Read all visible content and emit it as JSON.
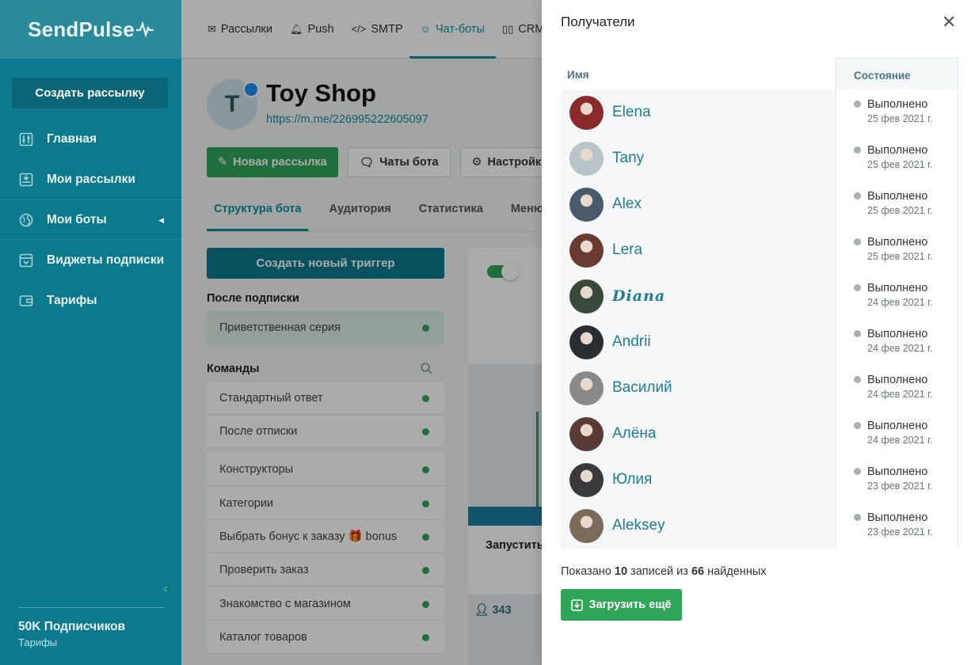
{
  "sidebar": {
    "logo": "SendPulse",
    "create_button": "Создать рассылку",
    "items": [
      {
        "label": "Главная",
        "icon": "sliders-icon"
      },
      {
        "label": "Мои рассылки",
        "icon": "inbox-icon"
      },
      {
        "label": "Мои боты",
        "icon": "globe-icon"
      },
      {
        "label": "Виджеты подписки",
        "icon": "widget-icon"
      },
      {
        "label": "Тарифы",
        "icon": "wallet-icon"
      }
    ],
    "footer_title": "50K Подписчиков",
    "footer_sub": "Тарифы"
  },
  "topnav": [
    {
      "label": "Рассылки",
      "icon": "email-icon"
    },
    {
      "label": "Push",
      "icon": "bell-icon"
    },
    {
      "label": "SMTP",
      "icon": "code-icon"
    },
    {
      "label": "Чат-боты",
      "icon": "chat-icon"
    },
    {
      "label": "CRM",
      "icon": "crm-icon"
    }
  ],
  "bot": {
    "avatar_letter": "T",
    "name": "Toy Shop",
    "link": "https://m.me/226995222605097"
  },
  "actions": {
    "new_campaign": "Новая рассылка",
    "bot_chats": "Чаты бота",
    "settings": "Настройки"
  },
  "subtabs": [
    "Структура бота",
    "Аудитория",
    "Статистика",
    "Меню"
  ],
  "triggers": {
    "create_button": "Создать новый триггер",
    "after_subscribe_title": "После подписки",
    "after_subscribe_item": "Приветственная серия",
    "commands_title": "Команды",
    "commands": [
      "Стандартный ответ",
      "После отписки"
    ],
    "others": [
      "Конструкторы",
      "Категории",
      "Выбрать бонус к заказу 🎁 bonus",
      "Проверить заказ",
      "Знакомство с магазином",
      "Каталог товаров"
    ]
  },
  "flow": {
    "node_text": "Запустить",
    "count": "343"
  },
  "drawer": {
    "title": "Получатели",
    "col_name": "Имя",
    "col_state": "Состояние",
    "recipients": [
      {
        "name": "Elena",
        "status": "Выполнено",
        "date": "25 фев 2021 г.",
        "avatar_color": "#8a2a2a",
        "script": false
      },
      {
        "name": "Tany",
        "status": "Выполнено",
        "date": "25 фев 2021 г.",
        "avatar_color": "#b8c4c8",
        "script": false
      },
      {
        "name": "Alex",
        "status": "Выполнено",
        "date": "25 фев 2021 г.",
        "avatar_color": "#4a5a6a",
        "script": false
      },
      {
        "name": "Lera",
        "status": "Выполнено",
        "date": "25 фев 2021 г.",
        "avatar_color": "#6a3a30",
        "script": false
      },
      {
        "name": "Diana",
        "status": "Выполнено",
        "date": "24 фев 2021 г.",
        "avatar_color": "#3a4a3a",
        "script": true
      },
      {
        "name": "Andrii",
        "status": "Выполнено",
        "date": "24 фев 2021 г.",
        "avatar_color": "#2a2e33",
        "script": false
      },
      {
        "name": "Василий",
        "status": "Выполнено",
        "date": "24 фев 2021 г.",
        "avatar_color": "#8a8a8a",
        "script": false
      },
      {
        "name": "Алёна",
        "status": "Выполнено",
        "date": "24 фев 2021 г.",
        "avatar_color": "#5a3a36",
        "script": false
      },
      {
        "name": "Юлия",
        "status": "Выполнено",
        "date": "23 фев 2021 г.",
        "avatar_color": "#3a3a3e",
        "script": false
      },
      {
        "name": "Aleksey",
        "status": "Выполнено",
        "date": "23 фев 2021 г.",
        "avatar_color": "#7a6a5a",
        "script": false
      }
    ],
    "summary_prefix": "Показано",
    "summary_shown": "10",
    "summary_mid": "записей из",
    "summary_total": "66",
    "summary_suffix": "найденных",
    "load_more": "Загрузить ещё"
  },
  "colors": {
    "sidebar_bg": "#0c7a8c",
    "accent": "#0c8fa3",
    "green": "#2fa55a",
    "name_link": "#1e7d95"
  }
}
